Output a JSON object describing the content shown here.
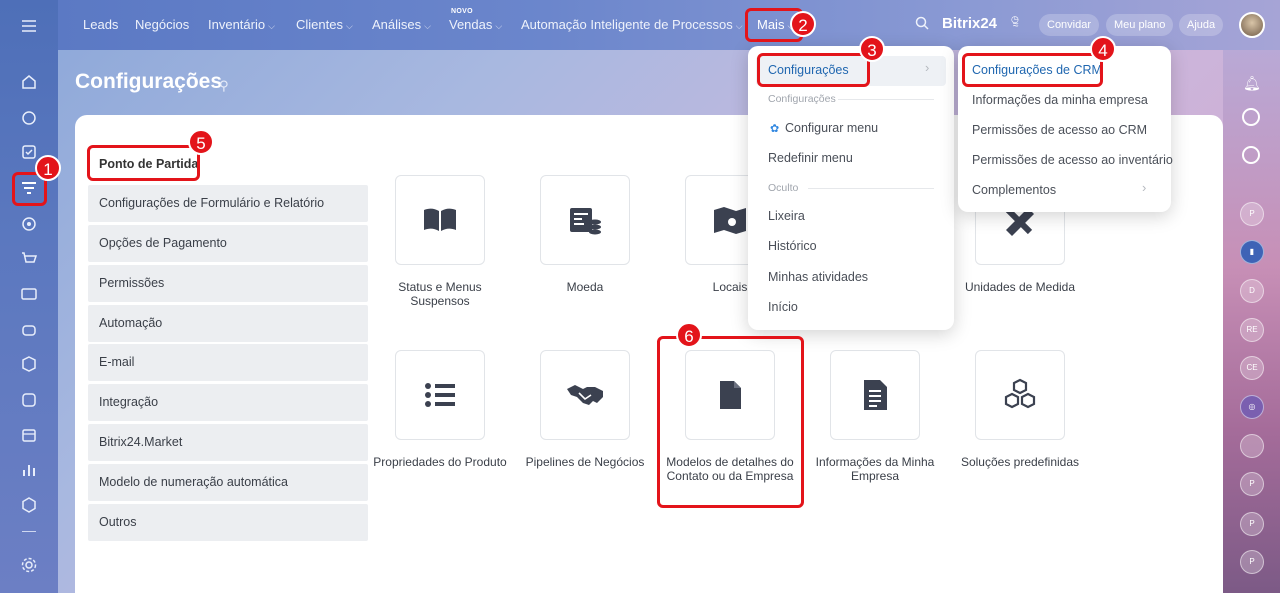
{
  "topnav": {
    "items": [
      "Leads",
      "Negócios",
      "Inventário",
      "Clientes",
      "Análises",
      "Vendas",
      "Automação Inteligente de Processos",
      "Mais"
    ],
    "novo_tag": "NOVO",
    "brand": "Bitrix24",
    "invite": "Convidar",
    "plan": "Meu plano",
    "help": "Ajuda"
  },
  "page": {
    "title": "Configurações"
  },
  "sidebar": {
    "first": "Ponto de Partida",
    "items": [
      "Configurações de Formulário e Relatório",
      "Opções de Pagamento",
      "Permissões",
      "Automação",
      "E-mail",
      "Integração",
      "Bitrix24.Market",
      "Modelo de numeração automática",
      "Outros"
    ]
  },
  "tiles": {
    "row1": [
      "Status e Menus Suspensos",
      "Moeda",
      "Locais",
      "Unidades de Medida"
    ],
    "row2": [
      "Propriedades do Produto",
      "Pipelines de Negócios",
      "Modelos de detalhes do Contato ou da Empresa",
      "Informações da Minha Empresa",
      "Soluções predefinidas"
    ]
  },
  "mais_menu": {
    "items": [
      "Configurações",
      "Configurar menu",
      "Redefinir menu",
      "Lixeira",
      "Histórico",
      "Minhas atividades",
      "Início"
    ],
    "section_config": "Configurações",
    "section_hidden": "Oculto"
  },
  "config_submenu": {
    "items": [
      "Configurações de CRM",
      "Informações da minha empresa",
      "Permissões de acesso ao CRM",
      "Permissões de acesso ao inventário",
      "Complementos"
    ]
  },
  "annotations": [
    "1",
    "2",
    "3",
    "4",
    "5",
    "6"
  ],
  "rightrail": [
    "P",
    "D",
    "RE",
    "CE",
    "P",
    "P",
    "P"
  ],
  "colors": {
    "accent": "#2067b0",
    "annotation_red": "#e3141a",
    "tile_icon": "#3b4150"
  }
}
